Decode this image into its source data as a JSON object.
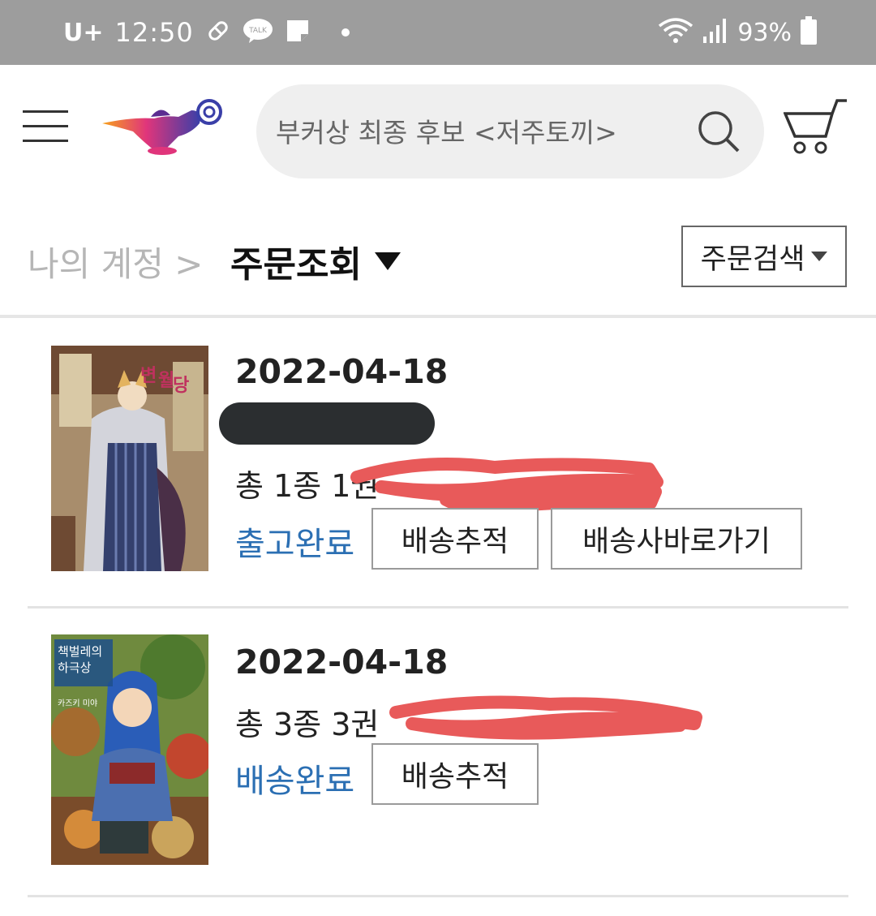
{
  "status_bar": {
    "carrier": "U+",
    "time": "12:50",
    "battery": "93%",
    "icons": [
      "pill-icon",
      "talk-icon",
      "note-icon",
      "dot-icon",
      "wifi-icon",
      "signal-icon",
      "battery-icon"
    ]
  },
  "header": {
    "search_placeholder": "부커상 최종 후보 <저주토끼>",
    "icons": [
      "menu-icon",
      "lamp-logo",
      "search-icon",
      "cart-icon"
    ]
  },
  "breadcrumb": {
    "parent": "나의 계정 >",
    "current": "주문조회"
  },
  "order_search_label": "주문검색",
  "orders": [
    {
      "date": "2022-04-18",
      "summary": "총 1종 1권",
      "status": "출고완료",
      "buttons": [
        "배송추적",
        "배송사바로가기"
      ]
    },
    {
      "date": "2022-04-18",
      "summary": "총 3종 3권",
      "status": "배송완료",
      "buttons": [
        "배송추적"
      ]
    }
  ],
  "colors": {
    "status_bar": "#9d9d9d",
    "search_bg": "#efefef",
    "status_text": "#2b6fb3",
    "redact": "#2b2e30",
    "scribble": "#e85a5a"
  }
}
